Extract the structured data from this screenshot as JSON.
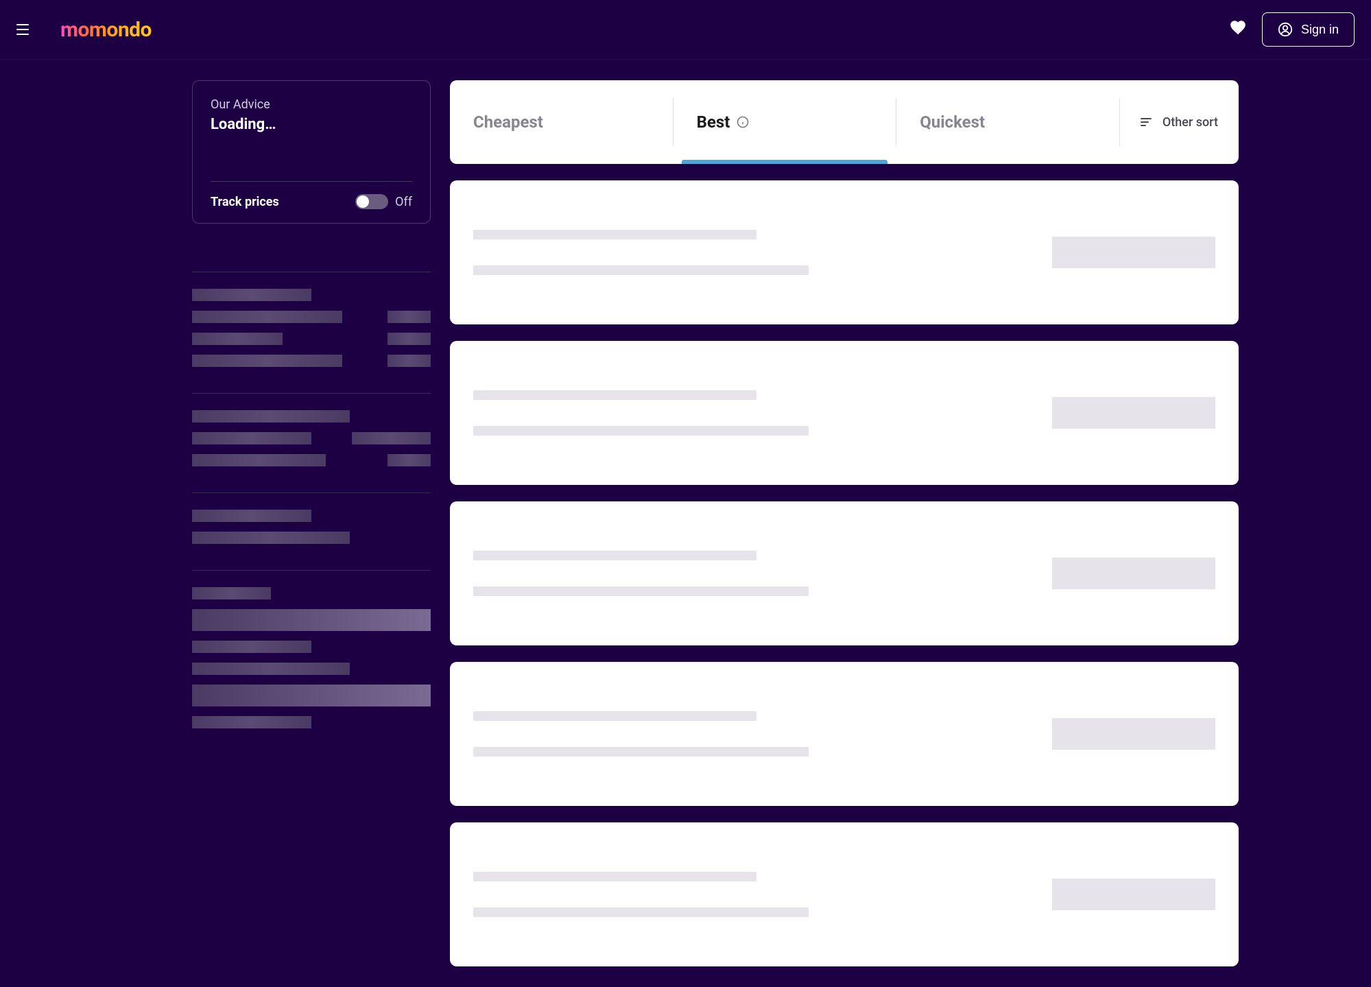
{
  "header": {
    "logo_text": "momondo",
    "sign_in_label": "Sign in"
  },
  "advice": {
    "title": "Our Advice",
    "status": "Loading…",
    "track_label": "Track prices",
    "toggle_state": "Off"
  },
  "sort": {
    "cheapest": "Cheapest",
    "best": "Best",
    "quickest": "Quickest",
    "other": "Other sort",
    "active": "best"
  },
  "results_count": 5,
  "filter_skeleton_groups": [
    {
      "rows": [
        {
          "l": 50,
          "r": 0
        },
        {
          "l": 63,
          "r": 18
        },
        {
          "l": 38,
          "r": 18
        },
        {
          "l": 63,
          "r": 18
        }
      ]
    },
    {
      "rows": [
        {
          "l": 66,
          "r": 0
        },
        {
          "l": 50,
          "r": 33
        },
        {
          "l": 56,
          "r": 18
        }
      ]
    },
    {
      "rows": [
        {
          "l": 50,
          "r": 0
        },
        {
          "l": 66,
          "r": 0
        }
      ]
    },
    {
      "rows": [
        {
          "l": 33,
          "r": 0
        },
        {
          "l": 100,
          "r": 0,
          "wide": true
        },
        {
          "l": 50,
          "r": 0
        },
        {
          "l": 66,
          "r": 0
        },
        {
          "l": 100,
          "r": 0,
          "wide": true
        },
        {
          "l": 50,
          "r": 0
        }
      ]
    }
  ]
}
